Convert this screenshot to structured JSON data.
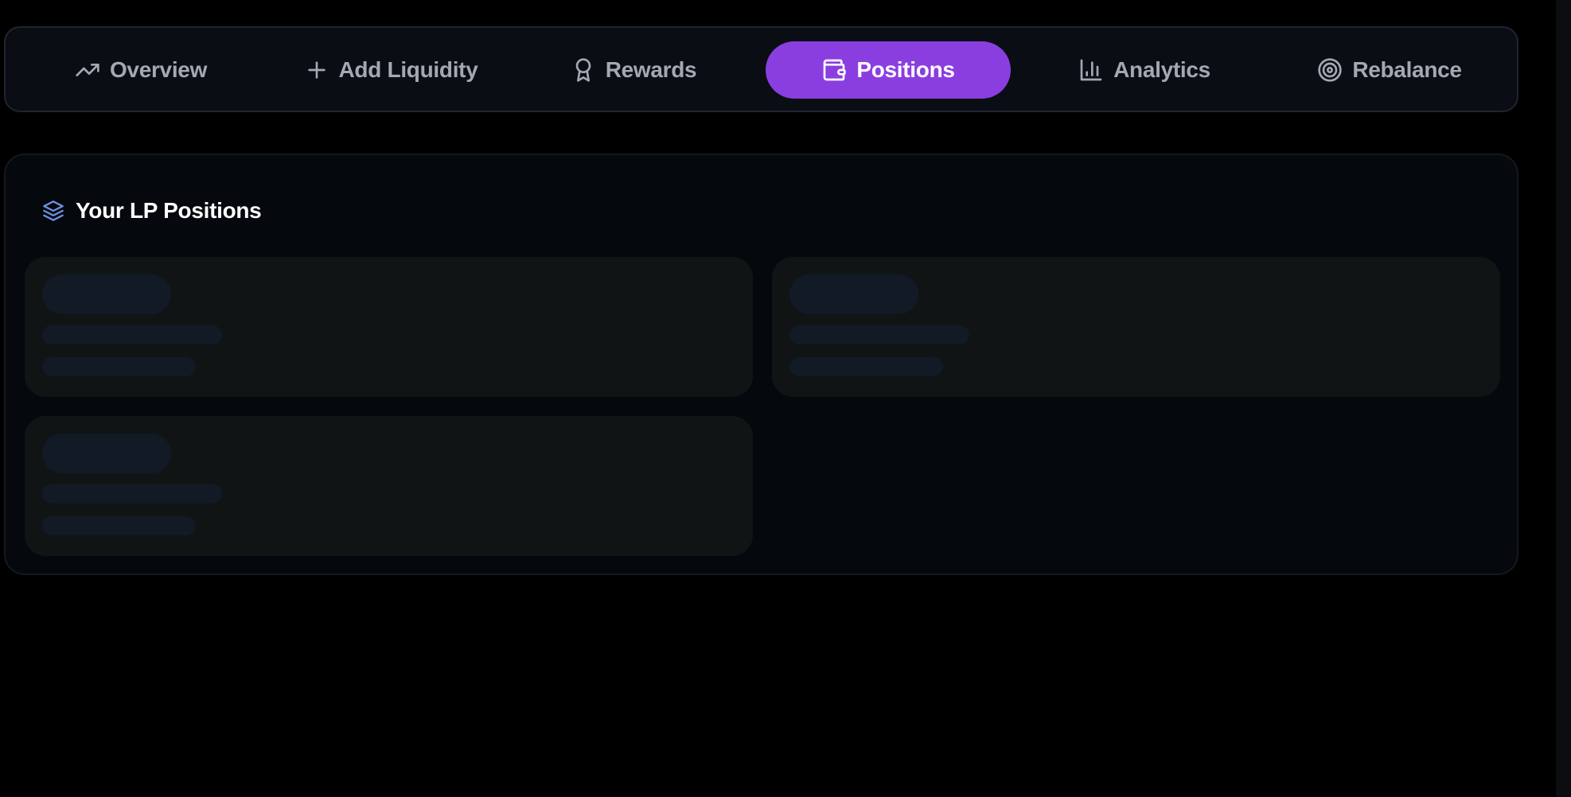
{
  "tabs": [
    {
      "id": "overview",
      "label": "Overview",
      "icon": "trending-up-icon",
      "active": false
    },
    {
      "id": "add-liquidity",
      "label": "Add Liquidity",
      "icon": "plus-icon",
      "active": false
    },
    {
      "id": "rewards",
      "label": "Rewards",
      "icon": "award-icon",
      "active": false
    },
    {
      "id": "positions",
      "label": "Positions",
      "icon": "wallet-icon",
      "active": true
    },
    {
      "id": "analytics",
      "label": "Analytics",
      "icon": "bar-chart-icon",
      "active": false
    },
    {
      "id": "rebalance",
      "label": "Rebalance",
      "icon": "target-icon",
      "active": false
    }
  ],
  "positions_panel": {
    "title": "Your LP Positions",
    "icon": "layers-icon",
    "loading": true,
    "skeleton_card_count": 3
  },
  "colors": {
    "accent": "#8a3ee0",
    "tab_text": "#a3a8b3",
    "layers_icon": "#6d8fe0",
    "background": "#000000"
  }
}
